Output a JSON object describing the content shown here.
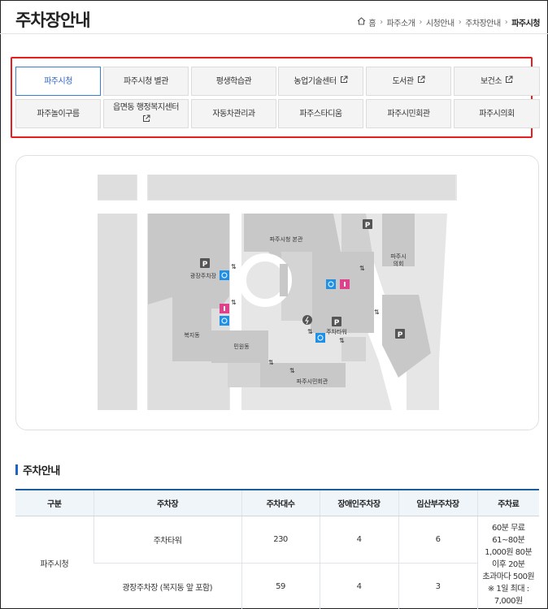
{
  "page": {
    "title": "주차장안내"
  },
  "breadcrumb": [
    "홈",
    "파주소개",
    "시청안내",
    "주차장안내",
    "파주시청"
  ],
  "tabs": [
    {
      "label": "파주시청",
      "active": true,
      "external": false
    },
    {
      "label": "파주시청 별관",
      "active": false,
      "external": false
    },
    {
      "label": "평생학습관",
      "active": false,
      "external": false
    },
    {
      "label": "농업기술센터",
      "active": false,
      "external": true
    },
    {
      "label": "도서관",
      "active": false,
      "external": true
    },
    {
      "label": "보건소",
      "active": false,
      "external": true
    },
    {
      "label": "파주놀이구름",
      "active": false,
      "external": false
    },
    {
      "label": "읍면동 행정복지센터",
      "active": false,
      "external": true
    },
    {
      "label": "자동차관리과",
      "active": false,
      "external": false
    },
    {
      "label": "파주스타디움",
      "active": false,
      "external": false
    },
    {
      "label": "파주시민회관",
      "active": false,
      "external": false
    },
    {
      "label": "파주시의회",
      "active": false,
      "external": false
    }
  ],
  "map": {
    "labels": {
      "main_building": "파주시청 본관",
      "council": "파주시\n의회",
      "plaza_parking": "광장주차장",
      "parking_tower": "주차타워",
      "welfare": "복지동",
      "civil": "민원동",
      "citizen_hall": "파주시민회관"
    },
    "colors": {
      "building": "#c8c8c8",
      "road": "#ffffff",
      "ground": "#e6e6e6",
      "parking_badge": "#555555",
      "accessible": "#1e90e6",
      "restroom": "#e0408c"
    }
  },
  "section": {
    "title": "주차안내"
  },
  "table": {
    "headers": [
      "구분",
      "주차장",
      "주차대수",
      "장애인주차장",
      "임산부주차장",
      "주차료"
    ],
    "group": "파주시청",
    "rows": [
      {
        "lot": "주차타워",
        "spaces": "230",
        "disabled": "4",
        "pregnant": "6"
      },
      {
        "lot": "광장주차장 (복지동 앞 포함)",
        "spaces": "59",
        "disabled": "4",
        "pregnant": "3"
      }
    ],
    "fee": [
      "60분 무료",
      "61~80분",
      "1,000원 80분",
      "이후 20분",
      "초과마다 500원",
      "※ 1일 최대 :",
      "7,000원"
    ]
  }
}
